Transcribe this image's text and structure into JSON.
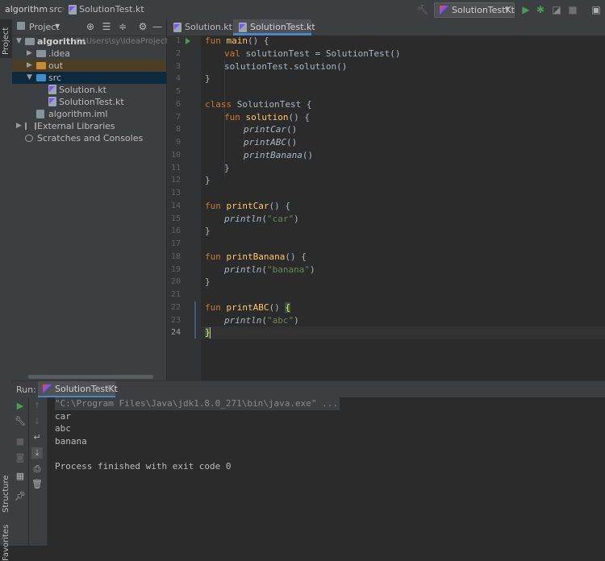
{
  "breadcrumb": {
    "project": "algorithm",
    "folder": "src",
    "file": "SolutionTest.kt"
  },
  "toolbar": {
    "run_config": "SolutionTestKt"
  },
  "left_strip": {
    "project_tab": "Project",
    "structure_tab": "Structure",
    "favorites_tab": "Favorites"
  },
  "project_panel": {
    "title": "Project",
    "tree": [
      {
        "label": "algorithm",
        "path": "C:\\Users\\sy\\IdeaProjects\\"
      },
      {
        "label": ".idea"
      },
      {
        "label": "out"
      },
      {
        "label": "src"
      },
      {
        "label": "Solution.kt"
      },
      {
        "label": "SolutionTest.kt"
      },
      {
        "label": "algorithm.iml"
      },
      {
        "label": "External Libraries"
      },
      {
        "label": "Scratches and Consoles"
      }
    ]
  },
  "editor": {
    "tabs": [
      {
        "label": "Solution.kt"
      },
      {
        "label": "SolutionTest.kt"
      }
    ],
    "line_numbers": [
      "1",
      "2",
      "3",
      "4",
      "5",
      "6",
      "7",
      "8",
      "9",
      "10",
      "11",
      "12",
      "13",
      "14",
      "15",
      "16",
      "17",
      "18",
      "19",
      "20",
      "21",
      "22",
      "23",
      "24"
    ],
    "code": {
      "l1_kw": "fun",
      "l1_fn": "main",
      "l1_rest": "() {",
      "l2_kw": "val",
      "l2_rest": " solutionTest = SolutionTest()",
      "l3": "solutionTest.solution()",
      "l4": "}",
      "l6_kw": "class",
      "l6_rest": " SolutionTest {",
      "l7_kw": "fun",
      "l7_fn": "solution",
      "l7_rest": "() {",
      "l8": "printCar",
      "l8_rest": "()",
      "l9": "printABC",
      "l9_rest": "()",
      "l10": "printBanana",
      "l10_rest": "()",
      "l11": "}",
      "l12": "}",
      "l14_kw": "fun",
      "l14_fn": "printCar",
      "l14_rest": "() {",
      "l15_fn": "println",
      "l15_open": "(",
      "l15_str": "\"car\"",
      "l15_close": ")",
      "l16": "}",
      "l18_kw": "fun",
      "l18_fn": "printBanana",
      "l18_rest": "() {",
      "l19_fn": "println",
      "l19_open": "(",
      "l19_str": "\"banana\"",
      "l19_close": ")",
      "l20": "}",
      "l22_kw": "fun",
      "l22_fn": "printABC",
      "l22_rest": "() ",
      "l22_brace": "{",
      "l23_fn": "println",
      "l23_open": "(",
      "l23_str": "\"abc\"",
      "l23_close": ")",
      "l24": "}"
    }
  },
  "run_panel": {
    "label": "Run:",
    "tab": "SolutionTestKt",
    "console": [
      "\"C:\\Program Files\\Java\\jdk1.8.0_271\\bin\\java.exe\" ...",
      "car",
      "abc",
      "banana",
      "",
      "Process finished with exit code 0"
    ]
  },
  "colors": {
    "keyword": "#cc7832",
    "function": "#ffc66d",
    "string": "#6a8759",
    "text": "#a9b7c6",
    "selection": "#0d293e",
    "accent": "#4a88c7"
  }
}
